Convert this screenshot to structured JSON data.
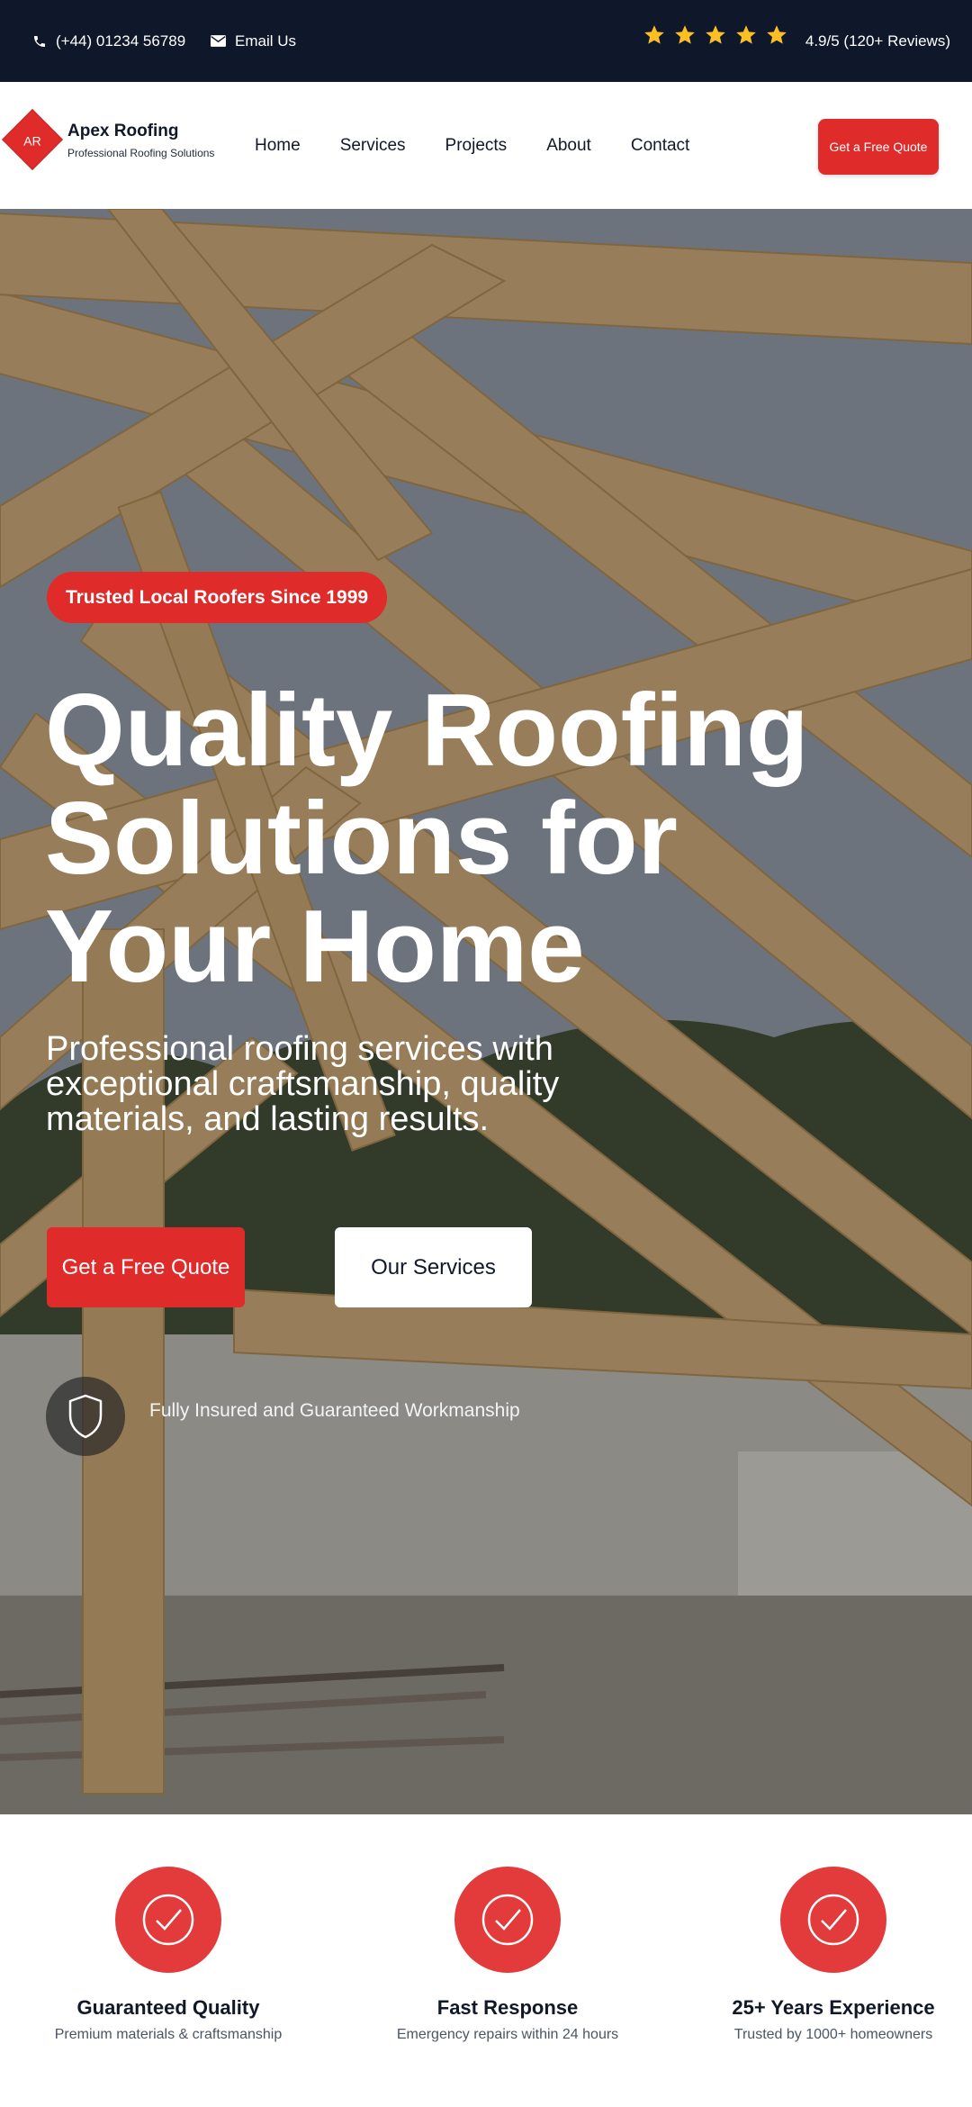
{
  "topbar": {
    "phone": "(+44) 01234 56789",
    "email_label": "Email Us",
    "stars": 5,
    "rating_text": "4.9/5 (120+ Reviews)",
    "star_color": "#fbbf24",
    "bg_color": "#0f172a"
  },
  "brand": {
    "logo_initials": "AR",
    "name": "Apex Roofing",
    "tagline": "Professional Roofing Solutions",
    "accent_color": "#e02b2b"
  },
  "nav": {
    "links": [
      "Home",
      "Services",
      "Projects",
      "About",
      "Contact"
    ],
    "cta_label": "Get a Free Quote"
  },
  "hero": {
    "badge": "Trusted Local Roofers Since 1999",
    "title": "Quality Roofing Solutions for Your Home",
    "subtitle": "Professional roofing services with exceptional craftsmanship, quality materials, and lasting results.",
    "primary_button": "Get a Free Quote",
    "secondary_button": "Our Services",
    "assurance_icon": "shield-icon",
    "assurance_text": "Fully Insured and Guaranteed Workmanship"
  },
  "features": [
    {
      "icon": "check-circle-icon",
      "title": "Guaranteed Quality",
      "description": "Premium materials & craftsmanship"
    },
    {
      "icon": "check-circle-icon",
      "title": "Fast Response",
      "description": "Emergency repairs within 24 hours"
    },
    {
      "icon": "check-circle-icon",
      "title": "25+ Years Experience",
      "description": "Trusted by 1000+ homeowners"
    }
  ]
}
